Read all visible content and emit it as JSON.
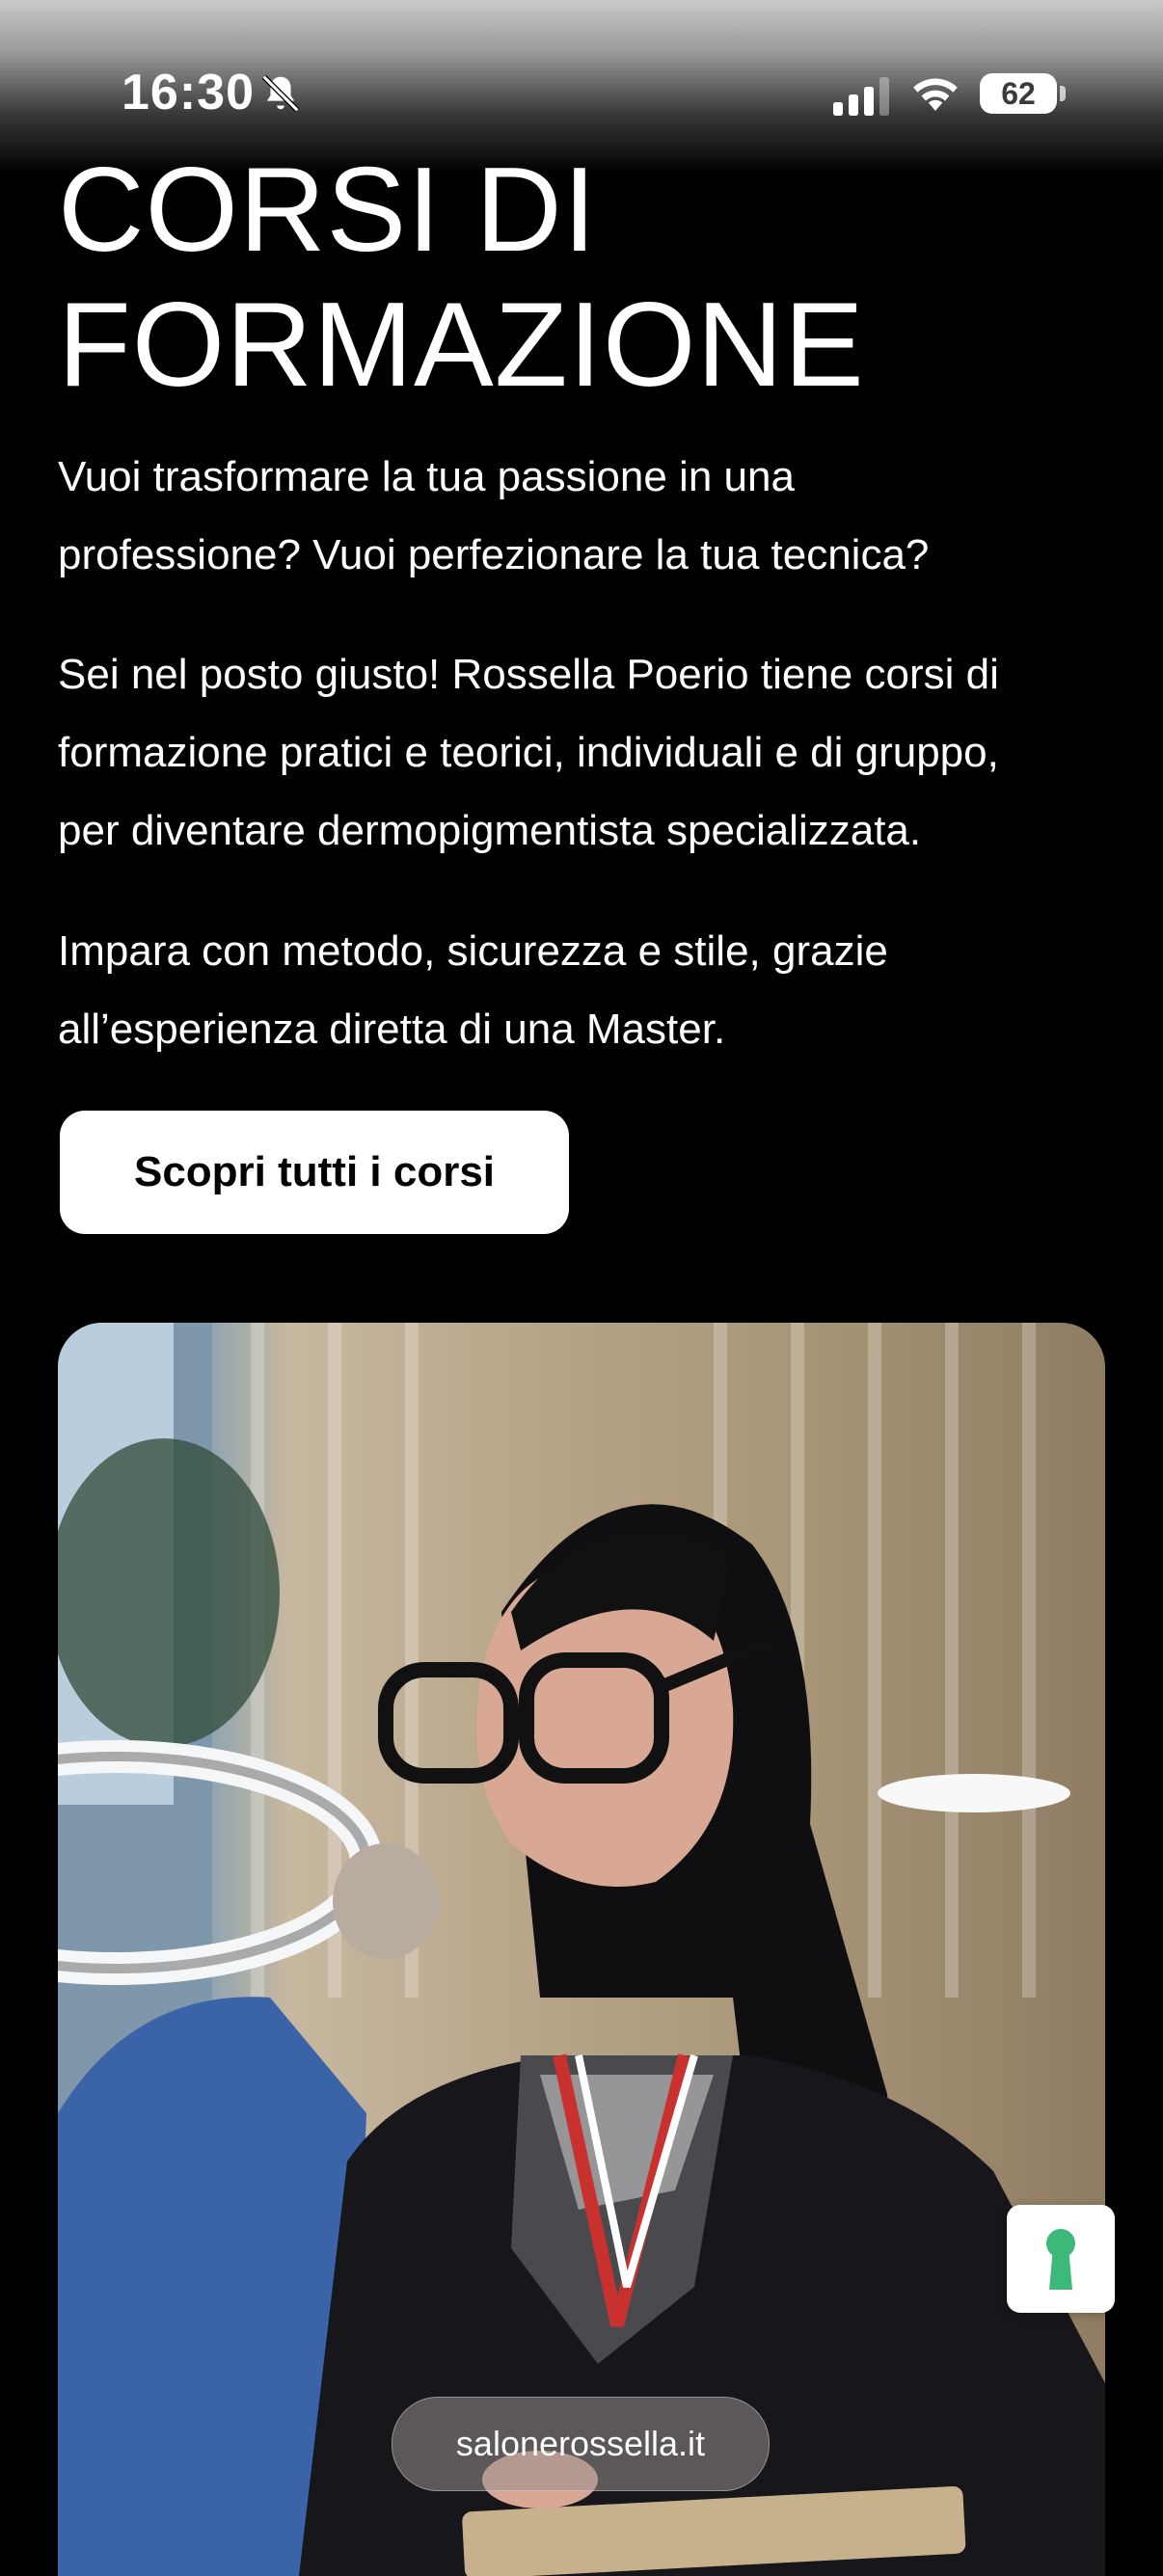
{
  "status_bar": {
    "time": "16:30",
    "battery": "62",
    "icons": [
      "bell-slash-icon",
      "cellular-signal-icon",
      "wifi-icon",
      "battery-icon"
    ]
  },
  "page": {
    "title_line1": "CORSI DI",
    "title_line2": "FORMAZIONE",
    "paragraph1_line1": "Vuoi trasformare la tua passione in una",
    "paragraph1_line2": "professione? Vuoi perfezionare la tua tecnica?",
    "paragraph2_line1": "Sei nel posto giusto! Rossella Poerio tiene corsi di",
    "paragraph2_line2": "formazione pratici e teorici, individuali e di gruppo,",
    "paragraph2_line3": "per diventare dermopigmentista specializzata.",
    "paragraph3_line1": "Impara con metodo, sicurezza e stile, grazie",
    "paragraph3_line2": "all’esperienza diretta di una Master.",
    "cta_label": "Scopri tutti i corsi"
  },
  "browser": {
    "url": "salonerossella.it"
  },
  "colors": {
    "background": "#000000",
    "text": "#ffffff",
    "button_bg": "#ffffff",
    "lock_icon": "#3cb878"
  }
}
